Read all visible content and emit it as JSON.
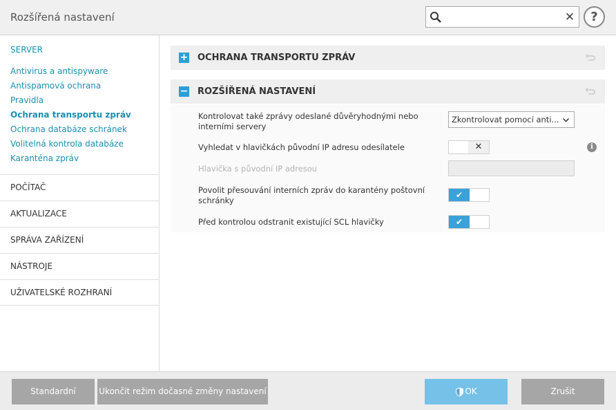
{
  "window": {
    "title": "Rozšířená nastavení"
  },
  "search": {
    "value": "",
    "placeholder": ""
  },
  "sidebar": {
    "section": "SERVER",
    "links": [
      {
        "label": "Antivirus a antispyware"
      },
      {
        "label": "Antispamová ochrana"
      },
      {
        "label": "Pravidla"
      },
      {
        "label": "Ochrana transportu zpráv",
        "active": true
      },
      {
        "label": "Ochrana databáze schránek"
      },
      {
        "label": "Volitelná kontrola databáze"
      },
      {
        "label": "Karanténa zpráv"
      }
    ],
    "categories": [
      {
        "label": "POČÍTAČ"
      },
      {
        "label": "AKTUALIZACE"
      },
      {
        "label": "SPRÁVA ZAŘÍZENÍ"
      },
      {
        "label": "NÁSTROJE"
      },
      {
        "label": "UŽIVATELSKÉ ROZHRANÍ"
      }
    ]
  },
  "sections": [
    {
      "title": "OCHRANA TRANSPORTU ZPRÁV",
      "toggle": "+",
      "expanded": false
    },
    {
      "title": "ROZŠÍŘENÁ NASTAVENÍ",
      "toggle": "−",
      "expanded": true
    }
  ],
  "settings": [
    {
      "label": "Kontrolovat také zprávy odeslané důvěryhodnými nebo interními servery",
      "control": "dropdown",
      "value": "Zkontrolovat pomocí anti..."
    },
    {
      "label": "Vyhledat v hlavičkách původní IP adresu odesílatele",
      "control": "toggle",
      "on": false,
      "info": "i"
    },
    {
      "label": "Hlavička s původní IP adresou",
      "control": "textbox",
      "value": "",
      "disabled": true
    },
    {
      "label": "Povolit přesouvání interních zpráv do karantény poštovní schránky",
      "control": "toggle",
      "on": true
    },
    {
      "label": "Před kontrolou odstranit existující SCL hlavičky",
      "control": "toggle",
      "on": true
    }
  ],
  "toggle_glyphs": {
    "off": "✕",
    "on": "✔"
  },
  "footer": {
    "default_label": "Standardní",
    "exit_temp_label": "Ukončit režim dočasné změny nastavení",
    "ok_label": "OK",
    "cancel_label": "Zrušit"
  },
  "colors": {
    "accent": "#2d9ed6",
    "link": "#1a8fb0",
    "ok_button": "#76c1e8",
    "button": "#a6a6a6"
  },
  "icons": {
    "search": "search-icon",
    "clear": "close-icon",
    "help": "help-icon",
    "revert": "revert-icon",
    "info": "info-icon",
    "ok": "shield-icon"
  },
  "help": {
    "glyph": "?"
  },
  "clear": {
    "glyph": "✕"
  }
}
